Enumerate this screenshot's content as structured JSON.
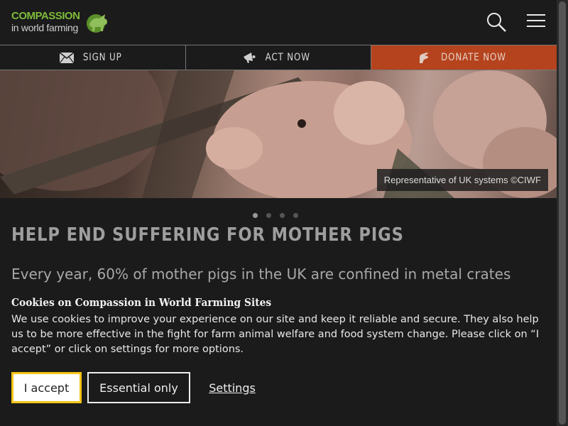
{
  "header": {
    "logo_line1": "COMPASSION",
    "logo_line2": "in world farming",
    "search_icon": "search-icon",
    "menu_icon": "hamburger-menu-icon"
  },
  "actions": [
    {
      "label": "SIGN UP",
      "icon": "envelope-icon"
    },
    {
      "label": "ACT NOW",
      "icon": "megaphone-icon"
    },
    {
      "label": "DONATE NOW",
      "icon": "donate-hand-icon"
    }
  ],
  "hero": {
    "caption": "Representative of UK systems ©CIWF",
    "slide_count": 4,
    "active_slide": 1
  },
  "headline": "HELP END SUFFERING FOR MOTHER PIGS",
  "subhead": "Every year, 60% of mother pigs in the UK are confined in metal crates",
  "cookie": {
    "title": "Cookies on Compassion in World Farming Sites",
    "text": "We use cookies to improve your experience on our site and keep it reliable and secure. They also help us to be more effective in the fight for farm animal welfare and food system change. Please click on “I accept” or click on settings for more options.",
    "accept_label": "I accept",
    "essential_label": "Essential only",
    "settings_label": "Settings"
  },
  "colors": {
    "background": "#1b1b1b",
    "donate": "#b5431d",
    "logo_green": "#7dbb3a",
    "accept_outline": "#f5c518"
  }
}
